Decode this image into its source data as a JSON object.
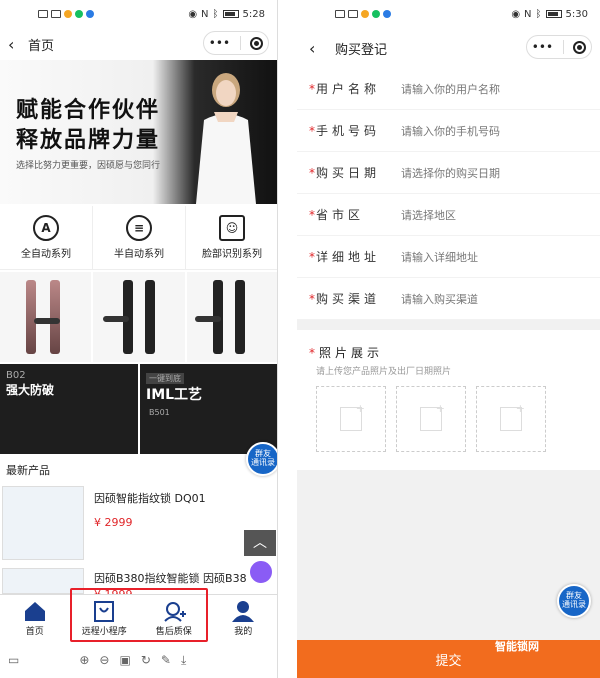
{
  "left": {
    "status": {
      "time": "5:28"
    },
    "nav": {
      "title": "首页",
      "capsule_more": "•••"
    },
    "banner": {
      "line1": "赋能合作伙伴",
      "line2": "释放品牌力量",
      "line3": "选择比努力更重要，因硕愿与您同行"
    },
    "categories": [
      {
        "label": "全自动系列",
        "icon": "A"
      },
      {
        "label": "半自动系列",
        "icon": "≡"
      },
      {
        "label": "脸部识别系列",
        "icon": "☺"
      }
    ],
    "promos": [
      {
        "p1": "B02",
        "p2": "强大防破"
      },
      {
        "p1": "一键到底",
        "p2": "IML工艺",
        "p3": "B501"
      }
    ],
    "float_btn": {
      "line1": "群友",
      "line2": "通讯录"
    },
    "section_title": "最新产品",
    "products": [
      {
        "name": "因硕智能指纹锁 DQ01",
        "price": "¥ 2999"
      },
      {
        "name": "因硕B380指纹智能锁 因硕B38",
        "price": "¥ 1999"
      }
    ],
    "up_arrow": "︿",
    "tabs": [
      {
        "label": "首页"
      },
      {
        "label": "远程小程序"
      },
      {
        "label": "售后质保"
      },
      {
        "label": "我的"
      }
    ]
  },
  "right": {
    "status": {
      "time": "5:30"
    },
    "nav": {
      "title": "购买登记",
      "capsule_more": "•••"
    },
    "fields": [
      {
        "label": "用户名称",
        "placeholder": "请输入你的用户名称"
      },
      {
        "label": "手机号码",
        "placeholder": "请输入你的手机号码"
      },
      {
        "label": "购买日期",
        "placeholder": "请选择你的购买日期"
      },
      {
        "label": "省市区",
        "placeholder": "请选择地区"
      },
      {
        "label": "详细地址",
        "placeholder": "请输入详细地址"
      },
      {
        "label": "购买渠道",
        "placeholder": "请输入购买渠道"
      }
    ],
    "photo": {
      "title": "照片展示",
      "hint": "请上传您产品照片及出厂日期照片"
    },
    "float_btn": {
      "line1": "群友",
      "line2": "通讯录"
    },
    "submit": "提交",
    "watermark": "智能锁网"
  },
  "colors": {
    "accent": "#f26c1e",
    "price": "#e0262a",
    "highlight": "#e8202a",
    "tab_blue": "#1a3f8f"
  }
}
